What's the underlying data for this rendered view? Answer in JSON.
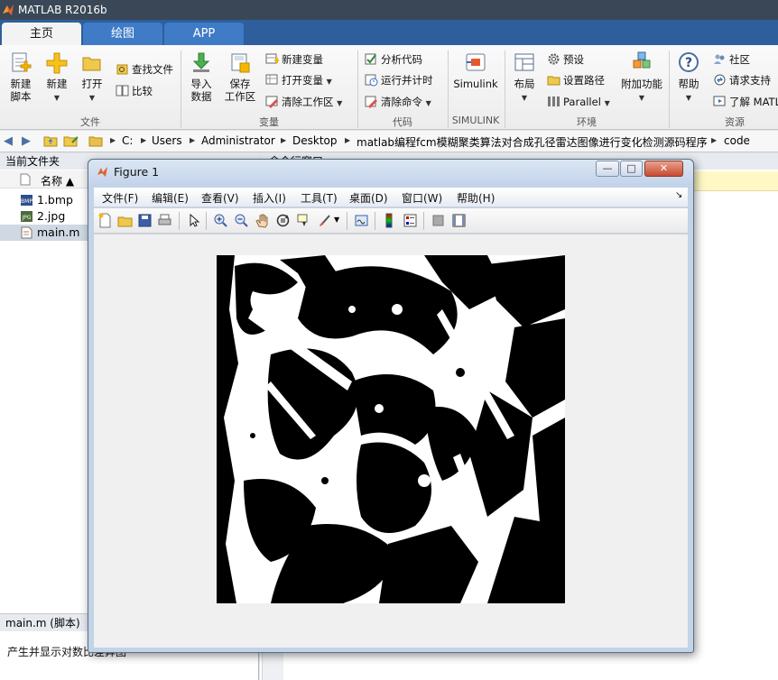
{
  "app": {
    "title": "MATLAB R2016b"
  },
  "ribbon_tabs": [
    {
      "label": "主页",
      "active": true
    },
    {
      "label": "绘图",
      "active": false
    },
    {
      "label": "APP",
      "active": false
    }
  ],
  "ribbon": {
    "file_group": {
      "label": "文件",
      "new_script": [
        "新建",
        "脚本"
      ],
      "new": "新建",
      "open": "打开",
      "find_files": "查找文件",
      "compare": "比较"
    },
    "variable_group": {
      "label": "变量",
      "import_data": [
        "导入",
        "数据"
      ],
      "save_workspace": [
        "保存",
        "工作区"
      ],
      "new_variable": "新建变量",
      "open_variable": "打开变量",
      "clear_workspace": "清除工作区"
    },
    "code_group": {
      "label": "代码",
      "analyze_code": "分析代码",
      "run_and_time": "运行并计时",
      "clear_commands": "清除命令"
    },
    "simulink_group": {
      "label": "SIMULINK",
      "simulink": "Simulink"
    },
    "environment_group": {
      "label": "环境",
      "layout": "布局",
      "preferences": "预设",
      "set_path": "设置路径",
      "parallel": "Parallel",
      "add_ons": "附加功能"
    },
    "resources_group": {
      "label": "资源",
      "help": "帮助",
      "community": "社区",
      "request_support": "请求支持",
      "learn_matlab": "了解 MATL"
    }
  },
  "address_bar": {
    "path": [
      "C:",
      "Users",
      "Administrator",
      "Desktop",
      "matlab编程fcm模糊聚类算法对合成孔径雷达图像进行变化检测源码程序",
      "code"
    ]
  },
  "current_folder": {
    "title": "当前文件夹",
    "column_name": "名称 ▲",
    "files": [
      {
        "name": "1.bmp",
        "type": "bmp",
        "selected": false
      },
      {
        "name": "2.jpg",
        "type": "jpg",
        "selected": false
      },
      {
        "name": "main.m",
        "type": "m",
        "selected": true
      }
    ],
    "details_title": "main.m  (脚本)",
    "details_text": "产生并显示对数比差异图"
  },
  "command_window": {
    "title": "命令行窗口"
  },
  "figure": {
    "title": "Figure 1",
    "menus": [
      "文件(F)",
      "编辑(E)",
      "查看(V)",
      "插入(I)",
      "工具(T)",
      "桌面(D)",
      "窗口(W)",
      "帮助(H)"
    ],
    "image_description": "binary black-and-white change detection image"
  },
  "colors": {
    "titlebar": "#3a4756",
    "tabstrip": "#2e5f9c",
    "ribbon": "#f3f3f3",
    "figure_frame": "#c3d3e8"
  }
}
